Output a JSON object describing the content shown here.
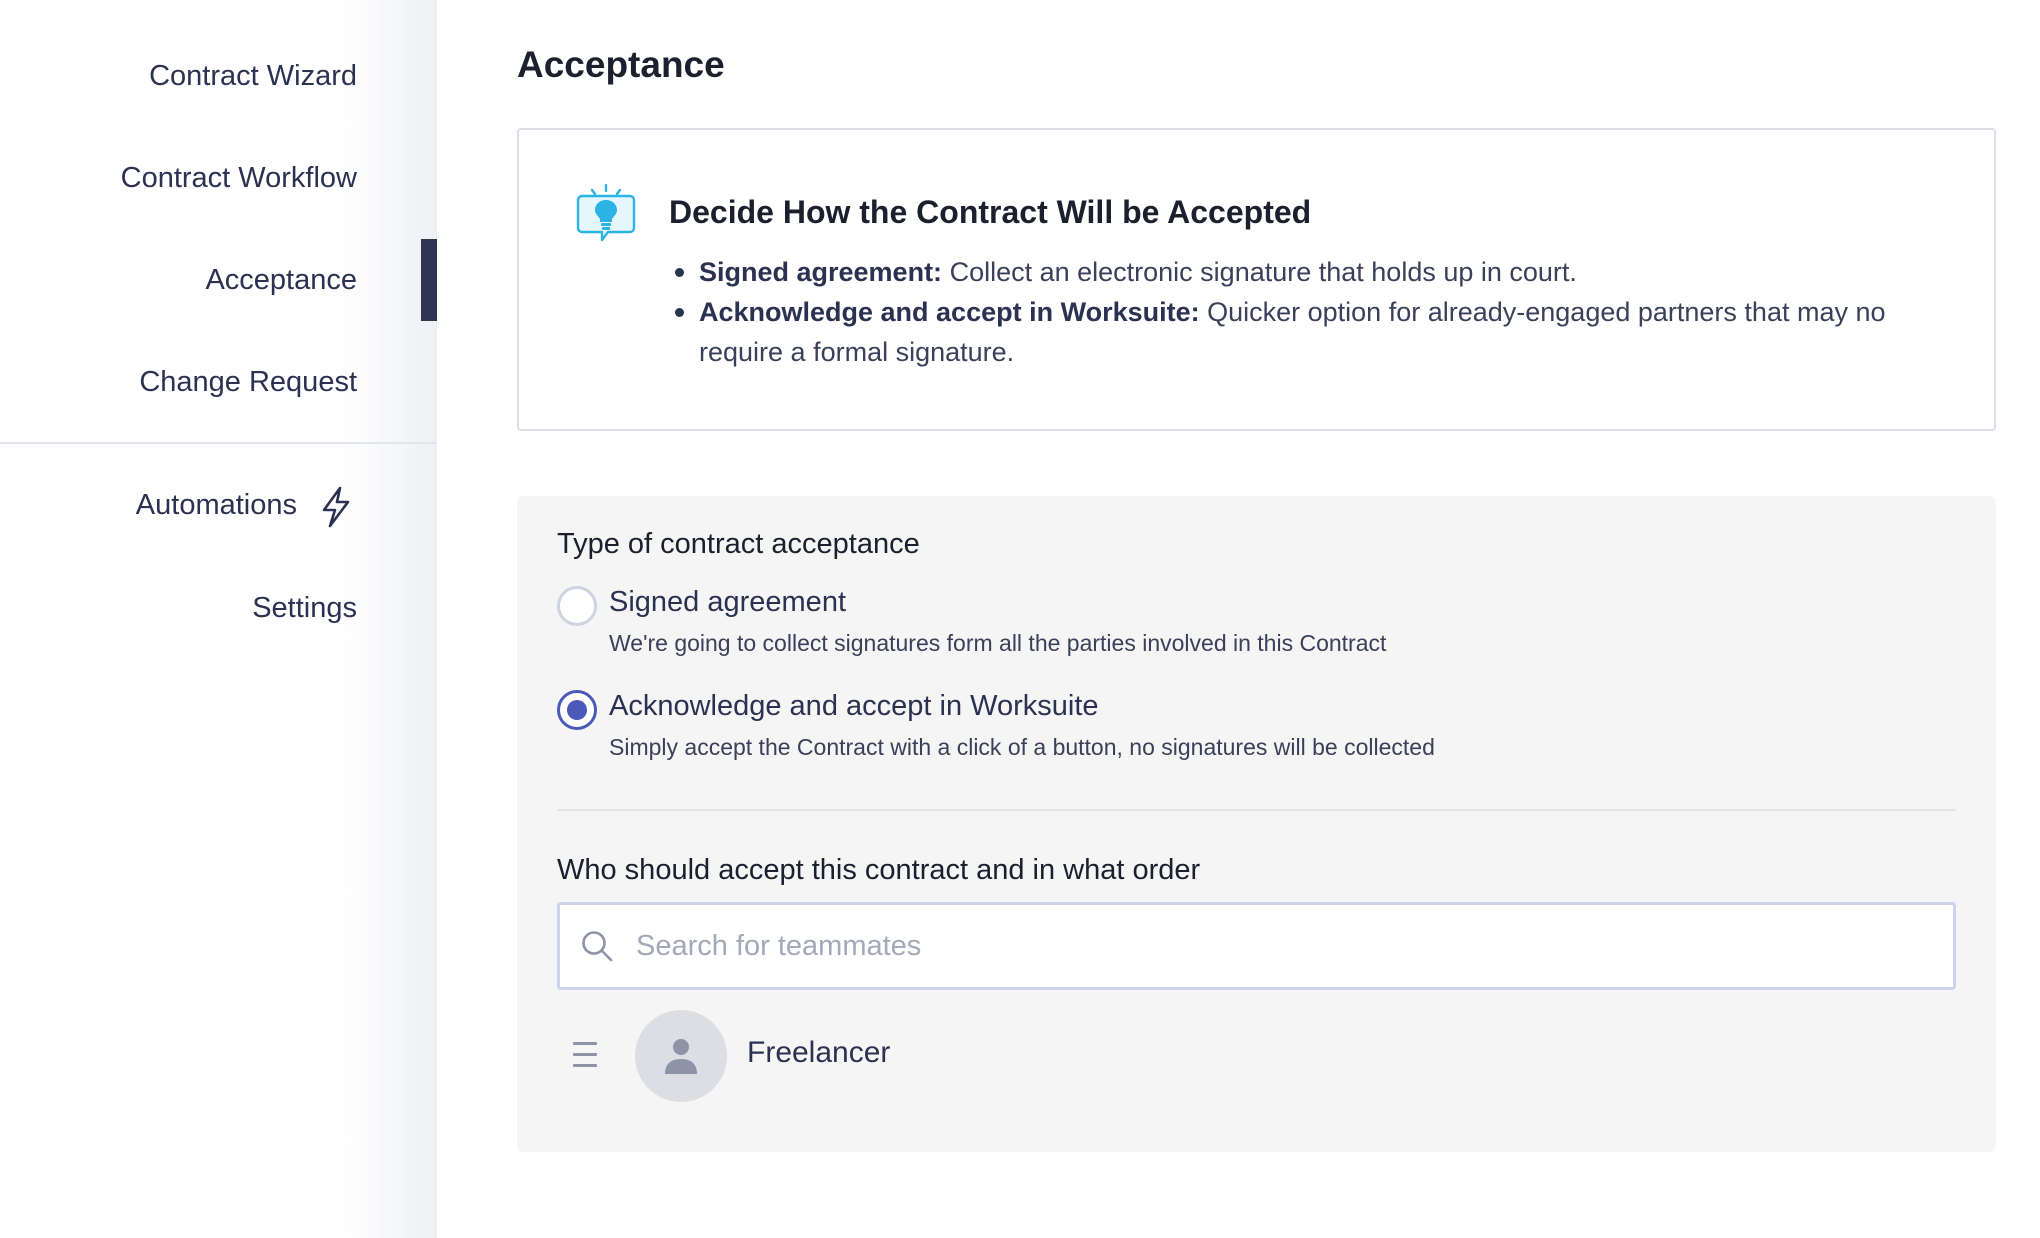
{
  "sidebar": {
    "items": [
      {
        "label": "Contract Wizard"
      },
      {
        "label": "Contract Workflow"
      },
      {
        "label": "Acceptance",
        "active": true
      },
      {
        "label": "Change Request"
      },
      {
        "label": "Automations",
        "icon": "bolt-icon"
      },
      {
        "label": "Settings"
      }
    ]
  },
  "page": {
    "title": "Acceptance"
  },
  "info": {
    "icon": "lightbulb-chat-icon",
    "title": "Decide How the Contract Will be Accepted",
    "bullets": [
      {
        "bold": "Signed agreement:",
        "text": " Collect an electronic signature that holds up in court."
      },
      {
        "bold": "Acknowledge and accept in Worksuite:",
        "text": " Quicker option for already-engaged partners that may no require a formal signature."
      }
    ]
  },
  "acceptance": {
    "section_label": "Type of contract acceptance",
    "options": [
      {
        "label": "Signed agreement",
        "description": "We're going to collect signatures form all the parties involved in this Contract",
        "selected": false
      },
      {
        "label": "Acknowledge and accept in Worksuite",
        "description": "Simply accept the Contract with a click of a button, no signatures will be collected",
        "selected": true
      }
    ]
  },
  "order": {
    "section_label": "Who should accept this contract and in what order",
    "search_placeholder": "Search for teammates",
    "search_value": "",
    "assignees": [
      {
        "name": "Freelancer",
        "avatar_icon": "person-icon"
      }
    ]
  },
  "colors": {
    "accent": "#4b59b8",
    "nav_active_bar": "#2f3552",
    "text": "#2b3150",
    "panel_bg": "#f5f5f6",
    "bulb": "#2bb3e6"
  }
}
